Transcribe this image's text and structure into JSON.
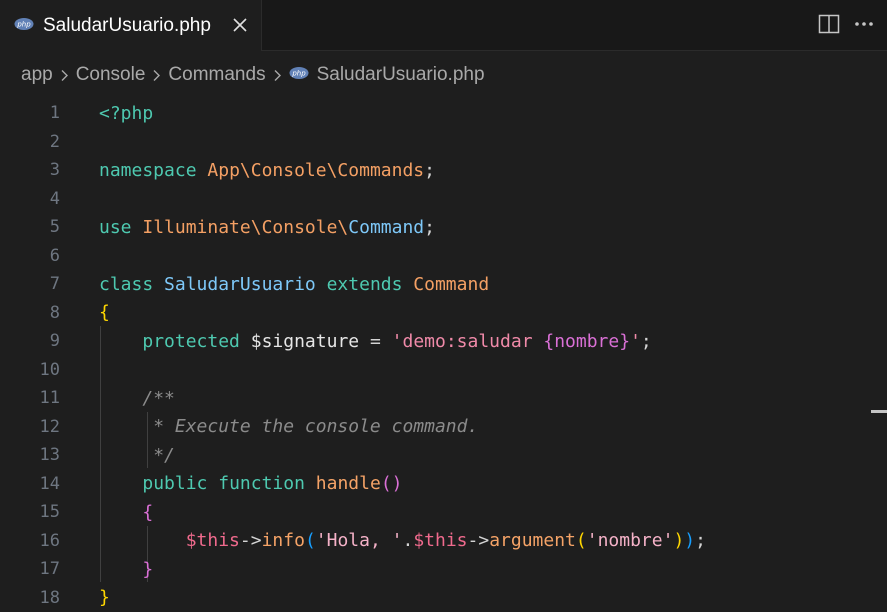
{
  "tab": {
    "label": "SaludarUsuario.php",
    "icon": "php-file-icon",
    "close_glyph": "✕"
  },
  "toolbar": {
    "split_icon": "split-editor-icon",
    "more_icon": "more-actions-icon"
  },
  "breadcrumb": {
    "items": [
      "app",
      "Console",
      "Commands"
    ],
    "file": "SaludarUsuario.php"
  },
  "editor": {
    "line_numbers": [
      "1",
      "2",
      "3",
      "4",
      "5",
      "6",
      "7",
      "8",
      "9",
      "10",
      "11",
      "12",
      "13",
      "14",
      "15",
      "16",
      "17",
      "18"
    ],
    "code": {
      "l1": "<?php",
      "l3_kw": "namespace",
      "l3_ns": "App\\Console\\Commands",
      "l3_end": ";",
      "l5_kw": "use",
      "l5_ns": "Illuminate\\Console\\",
      "l5_cls": "Command",
      "l5_end": ";",
      "l7_kw": "class",
      "l7_name": "SaludarUsuario",
      "l7_ext": "extends",
      "l7_parent": "Command",
      "l8": "{",
      "l9_kw": "protected",
      "l9_var": "$signature",
      "l9_eq": " = ",
      "l9_q1": "'",
      "l9_str": "demo:saludar ",
      "l9_arg": "{nombre}",
      "l9_q2": "'",
      "l9_end": ";",
      "l11": "/**",
      "l12": " * Execute the console command.",
      "l13": " */",
      "l14_kw1": "public",
      "l14_kw2": "function",
      "l14_fn": "handle",
      "l14_open": "(",
      "l14_close": ")",
      "l15": "{",
      "l16_this1": "$this",
      "l16_arrow1": "->",
      "l16_info": "info",
      "l16_open": "(",
      "l16_str1": "'Hola, '",
      "l16_dot": ".",
      "l16_this2": "$this",
      "l16_arrow2": "->",
      "l16_arg": "argument",
      "l16_open2": "(",
      "l16_str2": "'nombre'",
      "l16_close2": ")",
      "l16_close": ")",
      "l16_end": ";",
      "l17": "}",
      "l18": "}"
    }
  },
  "colors": {
    "background": "#1e1e1e",
    "keyword": "#4ec9b0",
    "namespace": "#f4a064",
    "string": "#f08aa9",
    "comment": "#8b8b8b"
  }
}
